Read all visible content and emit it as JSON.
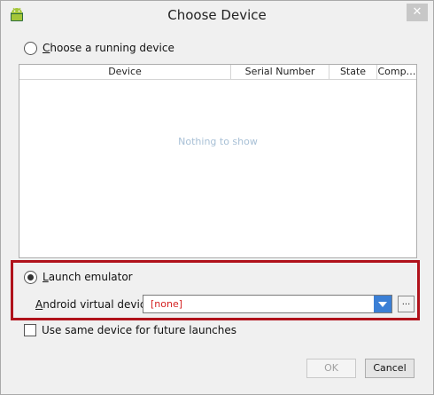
{
  "window": {
    "title": "Choose Device",
    "close_symbol": "✕"
  },
  "running": {
    "label": "Choose a running device"
  },
  "table": {
    "columns": [
      "Device",
      "Serial Number",
      "State",
      "Comp…"
    ],
    "empty_text": "Nothing to show"
  },
  "emulator": {
    "label": "Launch emulator",
    "avd_label": "Android virtual device:",
    "avd_value": "[none]",
    "browse_label": "..."
  },
  "future": {
    "label": "Use same device for future launches"
  },
  "buttons": {
    "ok": "OK",
    "cancel": "Cancel"
  },
  "colors": {
    "accent": "#3b7fd5",
    "highlight": "#b0121b",
    "error_text": "#d42020"
  }
}
